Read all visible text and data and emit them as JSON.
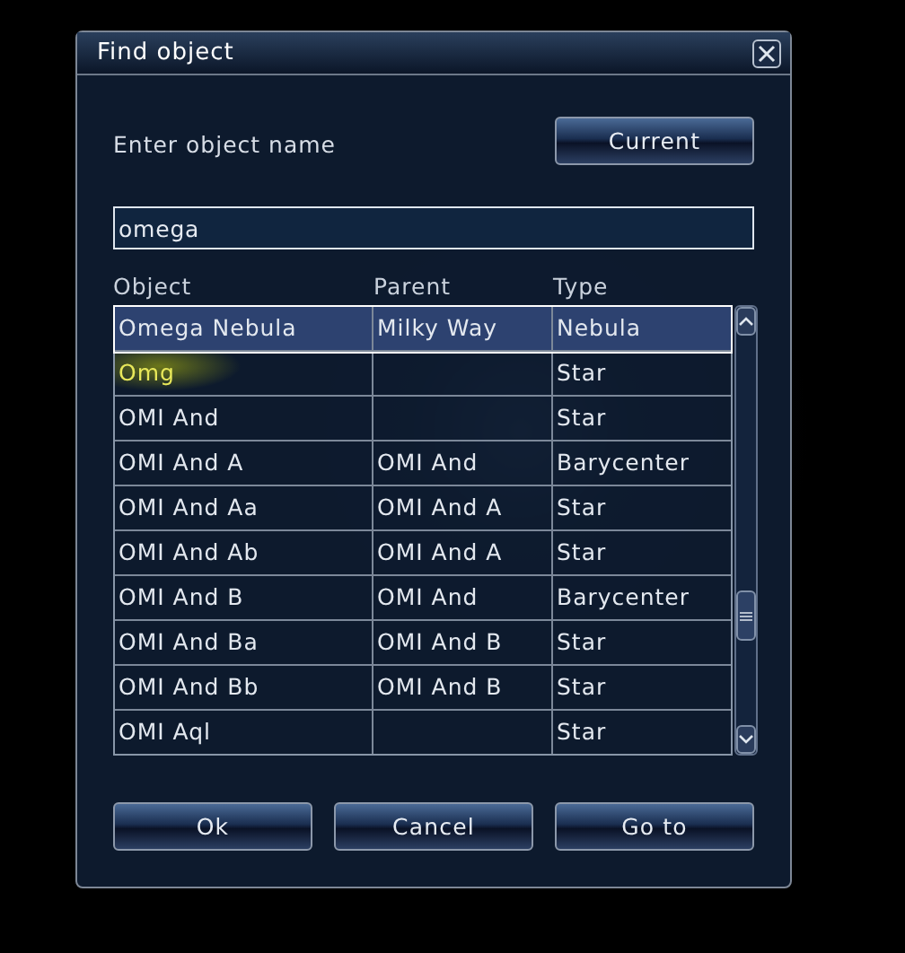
{
  "window": {
    "title": "Find object"
  },
  "prompt": "Enter object name",
  "current_button": "Current",
  "search": {
    "value": "omega"
  },
  "columns": [
    "Object",
    "Parent",
    "Type"
  ],
  "rows": [
    {
      "cells": [
        "Omega Nebula",
        "Milky Way",
        "Nebula"
      ],
      "selected": true,
      "hovered": false
    },
    {
      "cells": [
        "Omg",
        "",
        "Star"
      ],
      "selected": false,
      "hovered": true
    },
    {
      "cells": [
        "OMI And",
        "",
        "Star"
      ],
      "selected": false,
      "hovered": false
    },
    {
      "cells": [
        "OMI And A",
        "OMI And",
        "Barycenter"
      ],
      "selected": false,
      "hovered": false
    },
    {
      "cells": [
        "OMI And Aa",
        "OMI And A",
        "Star"
      ],
      "selected": false,
      "hovered": false
    },
    {
      "cells": [
        "OMI And Ab",
        "OMI And A",
        "Star"
      ],
      "selected": false,
      "hovered": false
    },
    {
      "cells": [
        "OMI And B",
        "OMI And",
        "Barycenter"
      ],
      "selected": false,
      "hovered": false
    },
    {
      "cells": [
        "OMI And Ba",
        "OMI And B",
        "Star"
      ],
      "selected": false,
      "hovered": false
    },
    {
      "cells": [
        "OMI And Bb",
        "OMI And B",
        "Star"
      ],
      "selected": false,
      "hovered": false
    },
    {
      "cells": [
        "OMI Aql",
        "",
        "Star"
      ],
      "selected": false,
      "hovered": false
    }
  ],
  "buttons": [
    "Ok",
    "Cancel",
    "Go to"
  ]
}
